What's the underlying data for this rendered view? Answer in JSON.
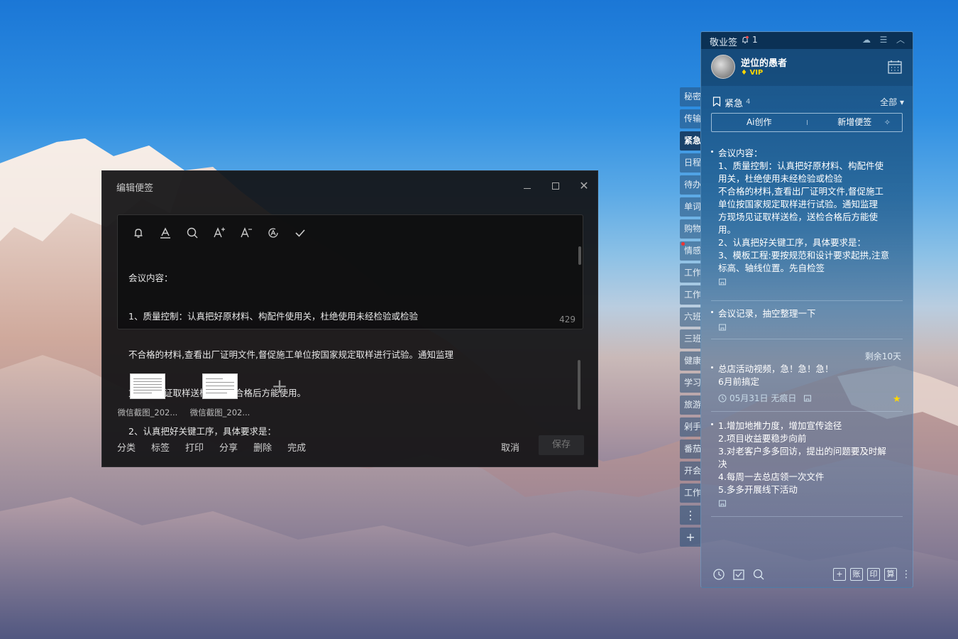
{
  "editor": {
    "title": "编辑便签",
    "content_lines": [
      "会议内容：",
      "1、质量控制：认真把好原材料、构配件使用关，杜绝使用未经检验或检验",
      "不合格的材料,查看出厂证明文件,督促施工单位按国家规定取样进行试验。通知监理",
      "方现场见证取样送检，送检合格后方能使用。",
      "2、认真把好关键工序，具体要求是："
    ],
    "char_count": "429",
    "attachments": [
      {
        "name": "微信截图_202..."
      },
      {
        "name": "微信截图_202..."
      }
    ],
    "actions": [
      "分类",
      "标签",
      "打印",
      "分享",
      "删除",
      "完成"
    ],
    "cancel_label": "取消",
    "save_label": "保存"
  },
  "side_tabs": [
    "秘密",
    "传输",
    "紧急",
    "日程",
    "待办",
    "单词",
    "购物",
    "情感",
    "工作",
    "工作",
    "六班",
    "三班",
    "健康",
    "学习",
    "旅游",
    "剁手",
    "番茄",
    "开会",
    "工作"
  ],
  "active_side_tab": 2,
  "panel": {
    "app_name": "敬业签",
    "bell_count": "1",
    "username": "逆位的愚者",
    "vip_label": "VIP",
    "list_title": "紧急",
    "list_count": "4",
    "filter_label": "全部",
    "ai_label": "Ai创作",
    "new_note_label": "新增便签",
    "notes": [
      {
        "lines": [
          "会议内容：",
          "1、质量控制：认真把好原材料、构配件使",
          "用关，杜绝使用未经检验或检验",
          "不合格的材料,查看出厂证明文件,督促施工",
          "单位按国家规定取样进行试验。通知监理",
          "方现场见证取样送检，送检合格后方能使",
          "用。",
          "2、认真把好关键工序，具体要求是：",
          "3、模板工程:要按规范和设计要求起拱,注意",
          "标高、轴线位置。先自检签"
        ]
      },
      {
        "lines": [
          "会议记录，抽空整理一下"
        ]
      },
      {
        "remain": "剩余10天",
        "lines": [
          "总店活动视频，急！急！急！",
          "6月前搞定"
        ],
        "date_meta": "05月31日 无痕日"
      },
      {
        "lines": [
          "1.增加地推力度，增加宣传途径",
          "2.项目收益要稳步向前",
          "3.对老客户多多回访，提出的问题要及时解",
          "决",
          "4.每周一去总店领一次文件",
          "5.多多开展线下活动"
        ]
      }
    ],
    "footer_buttons": [
      "账",
      "印",
      "算"
    ]
  }
}
